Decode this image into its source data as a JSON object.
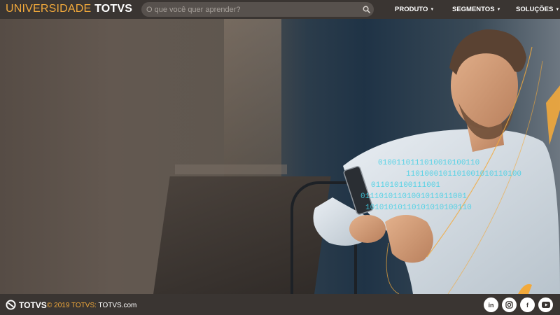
{
  "header": {
    "brand_light": "UNIVERSIDADE ",
    "brand_bold": "TOTVS",
    "search_placeholder": "O que você quer aprender?",
    "nav": [
      {
        "label": "PRODUTO"
      },
      {
        "label": "SEGMENTOS"
      },
      {
        "label": "SOLUÇÕES"
      }
    ]
  },
  "hero": {
    "binary_lines": [
      "0100110111010010100110",
      "1101000101101001010110100",
      "011010100111001",
      "01110101101001011011001",
      "10101010110101010100110"
    ]
  },
  "footer": {
    "logo_text": "TOTVS",
    "copyright": "© 2019 TOTVS: ",
    "site": "TOTVS.com",
    "social": [
      {
        "icon": "linkedin-icon",
        "label": "in"
      },
      {
        "icon": "instagram-icon",
        "label": ""
      },
      {
        "icon": "facebook-icon",
        "label": "f"
      },
      {
        "icon": "youtube-icon",
        "label": ""
      }
    ]
  },
  "colors": {
    "accent": "#f2a93b",
    "bar": "#3a3532",
    "binary": "#3fd0e6"
  }
}
